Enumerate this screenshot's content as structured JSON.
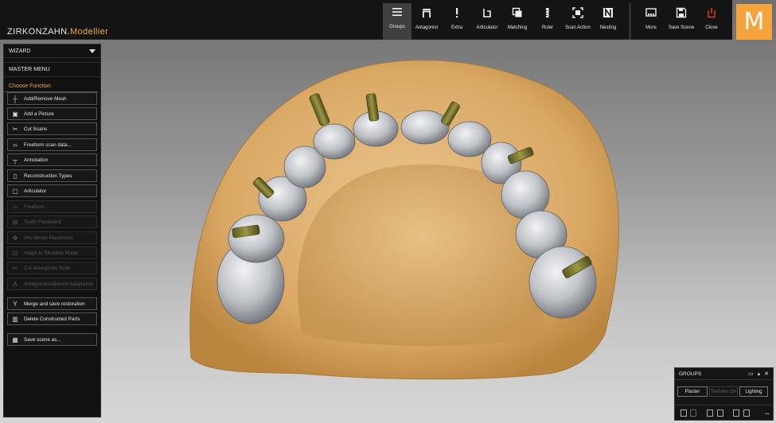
{
  "app": {
    "brand_prefix": "ZIRKONZAHN.",
    "brand_suffix": "Modellier",
    "logo_letter": "M"
  },
  "toolbar": {
    "items": [
      {
        "label": "Groups",
        "icon": "menu-icon",
        "active": true
      },
      {
        "label": "Antagonist",
        "icon": "antagonist-icon"
      },
      {
        "label": "Extra",
        "icon": "exclamation-icon"
      },
      {
        "label": "Articulator",
        "icon": "articulator-icon"
      },
      {
        "label": "Matching",
        "icon": "matching-icon"
      },
      {
        "label": "Ruler",
        "icon": "ruler-icon"
      },
      {
        "label": "Scan Action",
        "icon": "scan-action-icon"
      },
      {
        "label": "Nesting",
        "icon": "nesting-icon"
      },
      {
        "label": "More",
        "icon": "more-icon"
      },
      {
        "label": "Save Scene",
        "icon": "save-icon"
      },
      {
        "label": "Close",
        "icon": "close-power-icon",
        "accent": "#e03a2e"
      }
    ]
  },
  "sidebar": {
    "wizard_label": "WIZARD",
    "master_menu": "MASTER MENU",
    "choose_function": "Choose Function",
    "buttons": [
      {
        "label": "Add/Remove Mesh",
        "icon": "plus-icon",
        "enabled": true
      },
      {
        "label": "Add a Picture",
        "icon": "picture-icon",
        "enabled": true
      },
      {
        "label": "Cut Scans",
        "icon": "scissors-icon",
        "enabled": true
      },
      {
        "label": "Freeform scan data...",
        "icon": "freeform-icon",
        "enabled": true
      },
      {
        "label": "Annotation",
        "icon": "pin-icon",
        "enabled": true
      },
      {
        "label": "Reconstruction Types",
        "icon": "tooth-icon",
        "enabled": true
      },
      {
        "label": "Articulator",
        "icon": "articulator-icon",
        "enabled": true
      },
      {
        "label": "Freeform...",
        "icon": "freeform-icon",
        "enabled": false
      },
      {
        "label": "Tooth Placement",
        "icon": "tooth-placement-icon",
        "enabled": false
      },
      {
        "label": "Situ Model Placement",
        "icon": "move-icon",
        "enabled": false
      },
      {
        "label": "Adapt to Situation Model",
        "icon": "adapt-icon",
        "enabled": false
      },
      {
        "label": "Cut Waxup/situ Scan",
        "icon": "scissors-icon",
        "enabled": false
      },
      {
        "label": "Antagonist/Adjacent Adaptation",
        "icon": "letter-a-icon",
        "enabled": false
      },
      {
        "label": "Merge and save restoration",
        "icon": "merge-icon",
        "enabled": true
      },
      {
        "label": "Delete Constructed Parts",
        "icon": "trash-icon",
        "enabled": true
      },
      {
        "label": "Save scene as...",
        "icon": "save-scene-icon",
        "enabled": true
      }
    ]
  },
  "groups_panel": {
    "title": "GROUPS",
    "buttons": [
      {
        "label": "Plaster",
        "enabled": true
      },
      {
        "label": "Textures On",
        "enabled": false
      },
      {
        "label": "Lighting",
        "enabled": true
      }
    ],
    "more": "..."
  },
  "colors": {
    "accent": "#f2a93b",
    "plaster": "#deb06f",
    "teeth": "#c4c7cc",
    "implant": "#7c7a32"
  }
}
